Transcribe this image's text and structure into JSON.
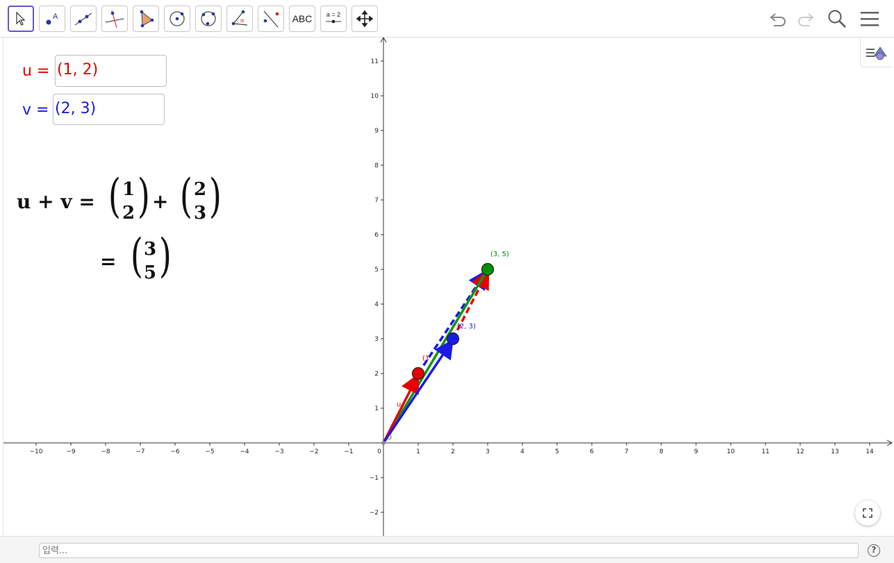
{
  "toolbar": {
    "tools": [
      {
        "name": "move-tool"
      },
      {
        "name": "point-tool"
      },
      {
        "name": "line-tool"
      },
      {
        "name": "perpendicular-line-tool"
      },
      {
        "name": "polygon-tool"
      },
      {
        "name": "circle-tool"
      },
      {
        "name": "circle-through-points-tool"
      },
      {
        "name": "angle-tool"
      },
      {
        "name": "reflect-tool"
      },
      {
        "name": "text-tool",
        "label": "ABC"
      },
      {
        "name": "slider-tool",
        "label": "a = 2"
      },
      {
        "name": "move-graphics-view-tool"
      }
    ],
    "right_icons": [
      "undo-icon",
      "redo-icon",
      "search-icon",
      "menu-icon"
    ]
  },
  "inputs": {
    "u": {
      "label": "u =",
      "value": "(1, 2)",
      "color": "#e60000"
    },
    "v": {
      "label": "v =",
      "value": "(2, 3)",
      "color": "#1a1ae6"
    }
  },
  "formula": {
    "lhs": "u + v =",
    "plus": "+",
    "eq": "=",
    "vec_u": [
      "1",
      "2"
    ],
    "vec_v": [
      "2",
      "3"
    ],
    "vec_sum": [
      "3",
      "5"
    ]
  },
  "graph": {
    "x_ticks": [
      "−10",
      "−9",
      "−8",
      "−7",
      "−6",
      "−5",
      "−4",
      "−3",
      "−2",
      "−1",
      "0",
      "1",
      "2",
      "3",
      "4",
      "5",
      "6",
      "7",
      "8",
      "9",
      "10",
      "11",
      "12",
      "13",
      "14"
    ],
    "y_ticks": [
      "−2",
      "−1",
      "1",
      "2",
      "3",
      "4",
      "5",
      "6",
      "7",
      "8",
      "9",
      "10",
      "11"
    ],
    "points": [
      {
        "name": "point-u",
        "x": 1,
        "y": 2,
        "color": "#e60000",
        "label": "(1"
      },
      {
        "name": "point-v",
        "x": 2,
        "y": 3,
        "color": "#1a1ae6",
        "label": "(2, 3)"
      },
      {
        "name": "point-sum",
        "x": 3,
        "y": 5,
        "color": "#008f00",
        "label": "(3, 5)"
      }
    ],
    "vector_labels": {
      "u": "u",
      "origin": "O"
    },
    "colors": {
      "u": "#e60000",
      "v": "#1a1ae6",
      "sum": "#119611"
    }
  },
  "input_bar": {
    "placeholder": "입력..."
  },
  "help_label": "?"
}
